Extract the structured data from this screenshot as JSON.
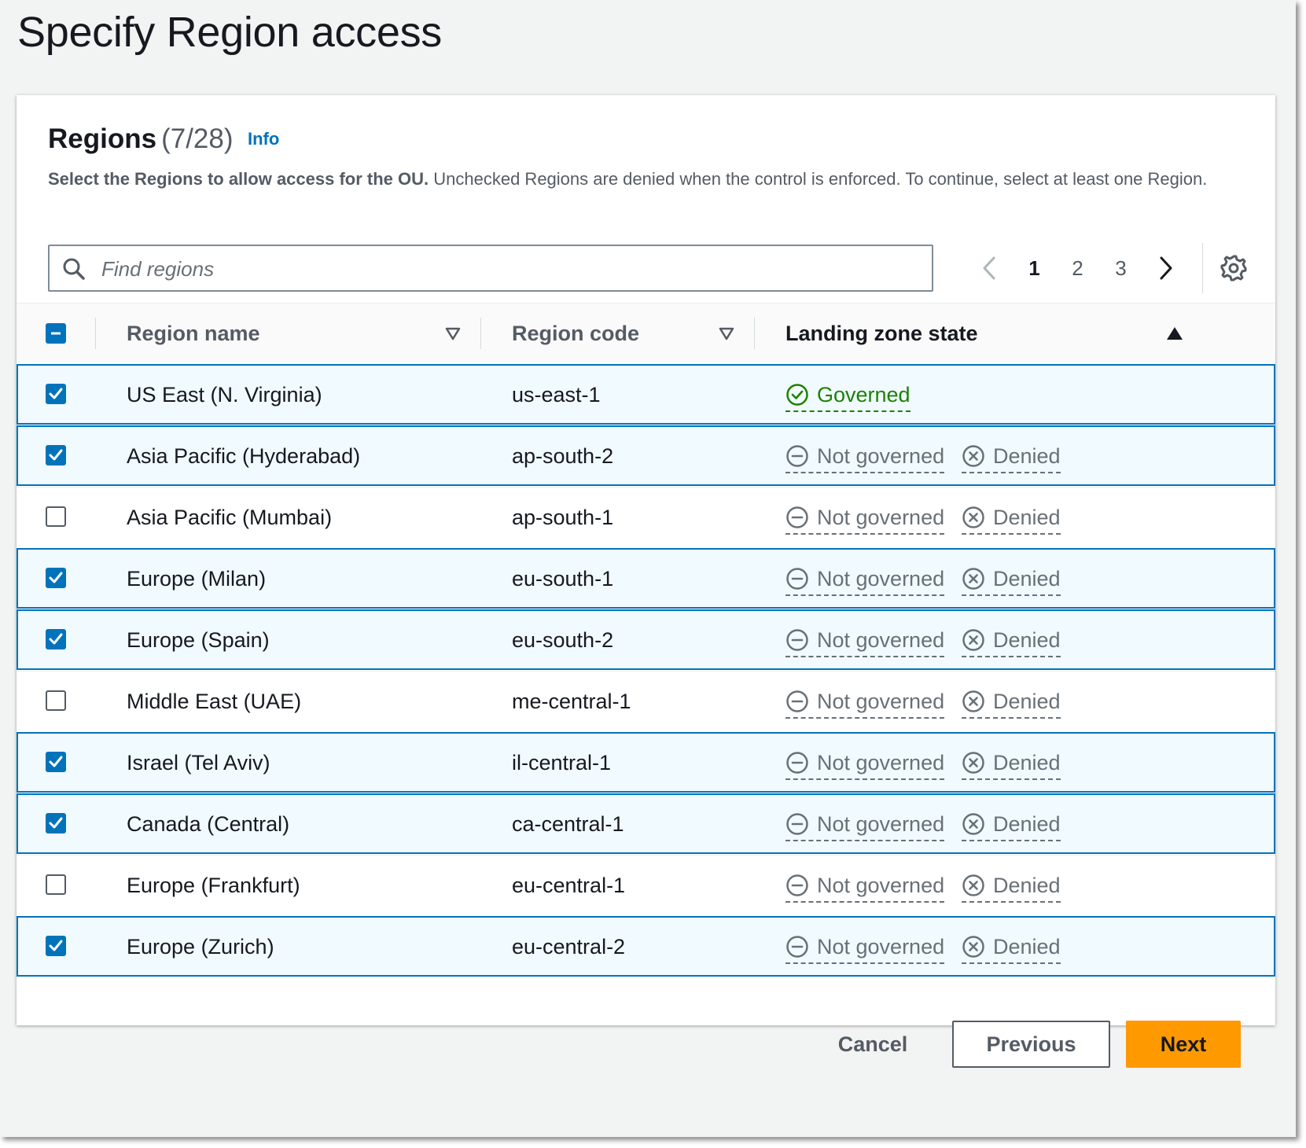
{
  "page": {
    "title": "Specify Region access"
  },
  "card": {
    "title": "Regions",
    "count": "(7/28)",
    "info_label": "Info",
    "desc_bold": "Select the Regions to allow access for the OU.",
    "desc_rest": " Unchecked Regions are denied when the control is enforced. To continue, select at least one Region."
  },
  "search": {
    "placeholder": "Find regions",
    "value": ""
  },
  "pagination": {
    "pages": [
      "1",
      "2",
      "3"
    ],
    "current": "1"
  },
  "table": {
    "columns": [
      "Region name",
      "Region code",
      "Landing zone state"
    ],
    "sorted_column": "Landing zone state",
    "rows": [
      {
        "name": "US East (N. Virginia)",
        "code": "us-east-1",
        "state": "Governed",
        "access": "",
        "selected": true
      },
      {
        "name": "Asia Pacific (Hyderabad)",
        "code": "ap-south-2",
        "state": "Not governed",
        "access": "Denied",
        "selected": true
      },
      {
        "name": "Asia Pacific (Mumbai)",
        "code": "ap-south-1",
        "state": "Not governed",
        "access": "Denied",
        "selected": false
      },
      {
        "name": "Europe (Milan)",
        "code": "eu-south-1",
        "state": "Not governed",
        "access": "Denied",
        "selected": true
      },
      {
        "name": "Europe (Spain)",
        "code": "eu-south-2",
        "state": "Not governed",
        "access": "Denied",
        "selected": true
      },
      {
        "name": "Middle East (UAE)",
        "code": "me-central-1",
        "state": "Not governed",
        "access": "Denied",
        "selected": false
      },
      {
        "name": "Israel (Tel Aviv)",
        "code": "il-central-1",
        "state": "Not governed",
        "access": "Denied",
        "selected": true
      },
      {
        "name": "Canada (Central)",
        "code": "ca-central-1",
        "state": "Not governed",
        "access": "Denied",
        "selected": true
      },
      {
        "name": "Europe (Frankfurt)",
        "code": "eu-central-1",
        "state": "Not governed",
        "access": "Denied",
        "selected": false
      },
      {
        "name": "Europe (Zurich)",
        "code": "eu-central-2",
        "state": "Not governed",
        "access": "Denied",
        "selected": true
      }
    ]
  },
  "actions": {
    "cancel": "Cancel",
    "previous": "Previous",
    "next": "Next"
  },
  "colors": {
    "accent": "#0073bb",
    "primary_button": "#ff9900",
    "success": "#1d8102",
    "muted": "#687078"
  },
  "icons": {
    "search": "search-icon",
    "prev_page": "chevron-left-icon",
    "next_page": "chevron-right-icon",
    "settings": "gear-icon",
    "governed": "check-circle-icon",
    "not_governed": "minus-circle-icon",
    "denied": "x-circle-icon",
    "sort": "caret-down-icon",
    "sorted": "caret-up-icon"
  }
}
